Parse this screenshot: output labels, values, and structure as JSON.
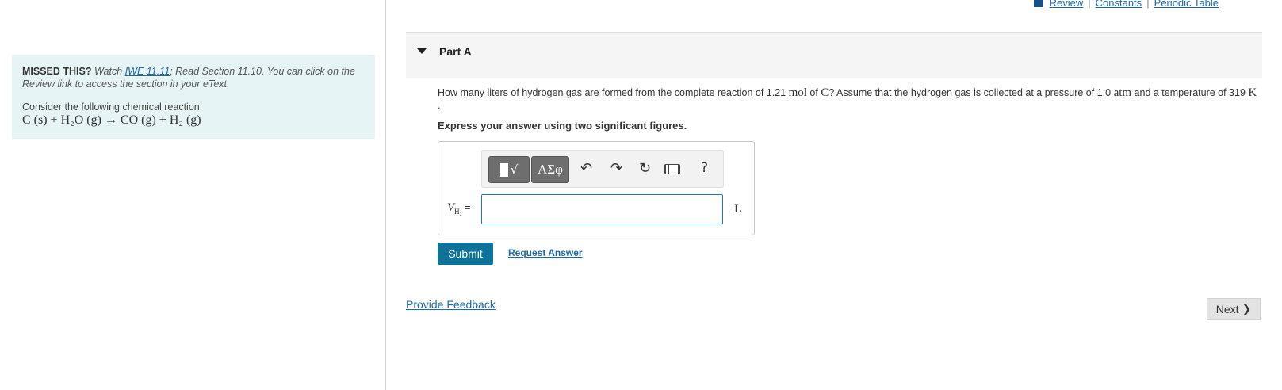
{
  "top_links": {
    "review": "Review",
    "constants": "Constants",
    "periodic_table": "Periodic Table",
    "separator": "|"
  },
  "left_panel": {
    "missed_label": "MISSED THIS?",
    "watch_text": " Watch ",
    "watch_link": "IWE 11.11",
    "rest_text": "; Read Section 11.10. You can click on the Review link to access the section in your eText.",
    "consider": "Consider the following chemical reaction:",
    "reaction": "C (s) + H₂O (g) → CO (g) + H₂ (g)"
  },
  "part": {
    "title": "Part A"
  },
  "question": {
    "t1": "How many liters of hydrogen gas are formed from the complete reaction of 1.21 ",
    "mol": "mol",
    "t2": " of ",
    "c": "C",
    "t3": "? Assume that the hydrogen gas is collected at a pressure of 1.0 ",
    "atm": "atm",
    "t4": " and a temperature of 319 ",
    "k": "K",
    "t5": " ."
  },
  "instruction": "Express your answer using two significant figures.",
  "answer": {
    "toolbar": {
      "greek_label": "ΑΣφ",
      "undo_icon": "↶",
      "redo_icon": "↷",
      "reset_icon": "↻",
      "help_label": "?",
      "templates_icon": "√"
    },
    "var_symbol": "V",
    "var_subscript": "H₂",
    "equals": "=",
    "input_value": "",
    "unit": "L"
  },
  "buttons": {
    "submit": "Submit",
    "request_answer": "Request Answer",
    "provide_feedback": "Provide Feedback",
    "next": "Next",
    "next_chevron": "❯"
  }
}
